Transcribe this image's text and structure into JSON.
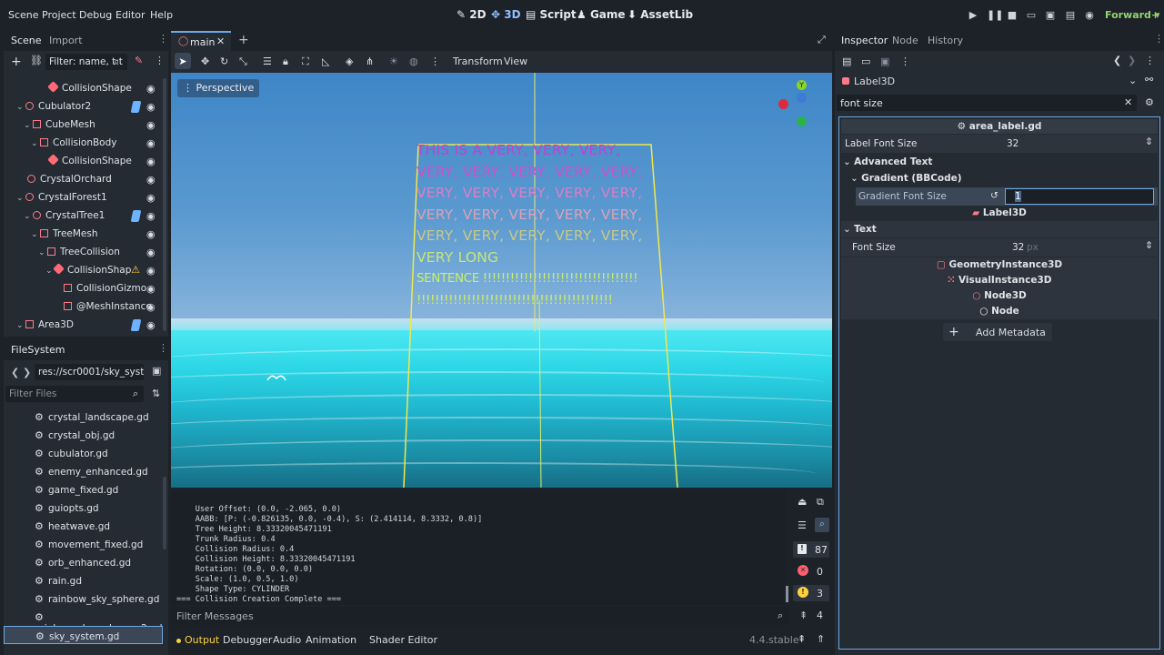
{
  "menu": {
    "scene": "Scene",
    "project": "Project",
    "debug": "Debug",
    "editor": "Editor",
    "help": "Help"
  },
  "workspaces": {
    "w2d": "2D",
    "w3d": "3D",
    "script": "Script",
    "game": "Game",
    "assetlib": "AssetLib"
  },
  "renderer": "Forward+",
  "scene_dock": {
    "tabs": [
      "Scene",
      "Import"
    ],
    "filter_placeholder": "Filter: name, t:t",
    "nodes": [
      {
        "label": "CollisionShape",
        "type": "coll"
      },
      {
        "label": "Cubulator2",
        "type": "node"
      },
      {
        "label": "CubeMesh",
        "type": "mesh"
      },
      {
        "label": "CollisionBody",
        "type": "mesh"
      },
      {
        "label": "CollisionShape",
        "type": "coll"
      },
      {
        "label": "CrystalOrchard",
        "type": "node"
      },
      {
        "label": "CrystalForest1",
        "type": "node"
      },
      {
        "label": "CrystalTree1",
        "type": "node"
      },
      {
        "label": "TreeMesh",
        "type": "mesh"
      },
      {
        "label": "TreeCollision",
        "type": "mesh"
      },
      {
        "label": "CollisionShap",
        "type": "coll"
      },
      {
        "label": "CollisionGizmo",
        "type": "mesh"
      },
      {
        "label": "@MeshInstance",
        "type": "mesh"
      },
      {
        "label": "Area3D",
        "type": "mesh"
      }
    ]
  },
  "filesystem": {
    "title": "FileSystem",
    "path": "res://scr0001/sky_system.",
    "filter_placeholder": "Filter Files",
    "files": [
      "crystal_landscape.gd",
      "crystal_obj.gd",
      "cubulator.gd",
      "enemy_enhanced.gd",
      "game_fixed.gd",
      "guiopts.gd",
      "heatwave.gd",
      "movement_fixed.gd",
      "orb_enhanced.gd",
      "rain.gd",
      "rainbow_sky_sphere.gd",
      "rainbow_sky_sphere_v2.gd",
      "sky_system.gd"
    ]
  },
  "editor_tabs": {
    "main": "main"
  },
  "viewport": {
    "toolbar_transform": "Transform",
    "toolbar_view": "View",
    "perspective": "Perspective",
    "label_lines": [
      {
        "text": "THIS IS A VERY, VERY, VERY,",
        "color": "#c63ed1"
      },
      {
        "text": "VERY, VERY, VERY, VERY, VERY,",
        "color": "#cf4fcf"
      },
      {
        "text": "VERY, VERY, VERY, VERY, VERY,",
        "color": "#d97fc9"
      },
      {
        "text": "VERY, VERY, VERY, VERY, VERY,",
        "color": "#d9a2b8"
      },
      {
        "text": "VERY, VERY, VERY, VERY, VERY,",
        "color": "#c9c986"
      },
      {
        "text": "VERY LONG",
        "color": "#c8e67a"
      },
      {
        "text": "SENTENCE !!!!!!!!!!!!!!!!!!!!!!!!!!!!!!!!!!",
        "color": "#c9ef6a"
      },
      {
        "text": "!!!!!!!!!!!!!!!!!!!!!!!!!!!!!!!!!!!!!!!!!!!",
        "color": "#d1f060"
      }
    ],
    "gizmo_y": "Y"
  },
  "output": {
    "lines": [
      "    User Offset: (0.0, -2.065, 0.0)",
      "    AABB: [P: (-0.826135, 0.0, -0.4), S: (2.414114, 8.3332, 0.8)]",
      "    Tree Height: 8.33320045471191",
      "    Trunk Radius: 0.4",
      "    Collision Radius: 0.4",
      "    Collision Height: 8.33320045471191",
      "    Rotation: (0.0, 0.0, 0.0)",
      "    Scale: (1.0, 0.5, 1.0)",
      "    Shape Type: CYLINDER",
      "=== Collision Creation Complete ==="
    ],
    "filter_placeholder": "Filter Messages",
    "counts": {
      "messages": "87",
      "errors": "0",
      "warnings": "3",
      "other": "4"
    },
    "bottom_tabs": [
      "Output",
      "Debugger",
      "Audio",
      "Animation",
      "Shader Editor"
    ],
    "version": "4.4.stable"
  },
  "inspector": {
    "tabs": [
      "Inspector",
      "Node",
      "History"
    ],
    "node_name": "Label3D",
    "search_value": "font size",
    "script_name": "area_label.gd",
    "label_font_size_label": "Label Font Size",
    "label_font_size_value": "32",
    "advanced_text": "Advanced Text",
    "gradient": "Gradient (BBCode)",
    "gradient_font_size_label": "Gradient Font Size",
    "gradient_font_size_value": "1",
    "label3d_header": "Label3D",
    "text_section": "Text",
    "font_size_label": "Font Size",
    "font_size_value": "32",
    "font_size_unit": "px",
    "classes": [
      "GeometryInstance3D",
      "VisualInstance3D",
      "Node3D",
      "Node"
    ],
    "add_metadata": "Add Metadata"
  }
}
